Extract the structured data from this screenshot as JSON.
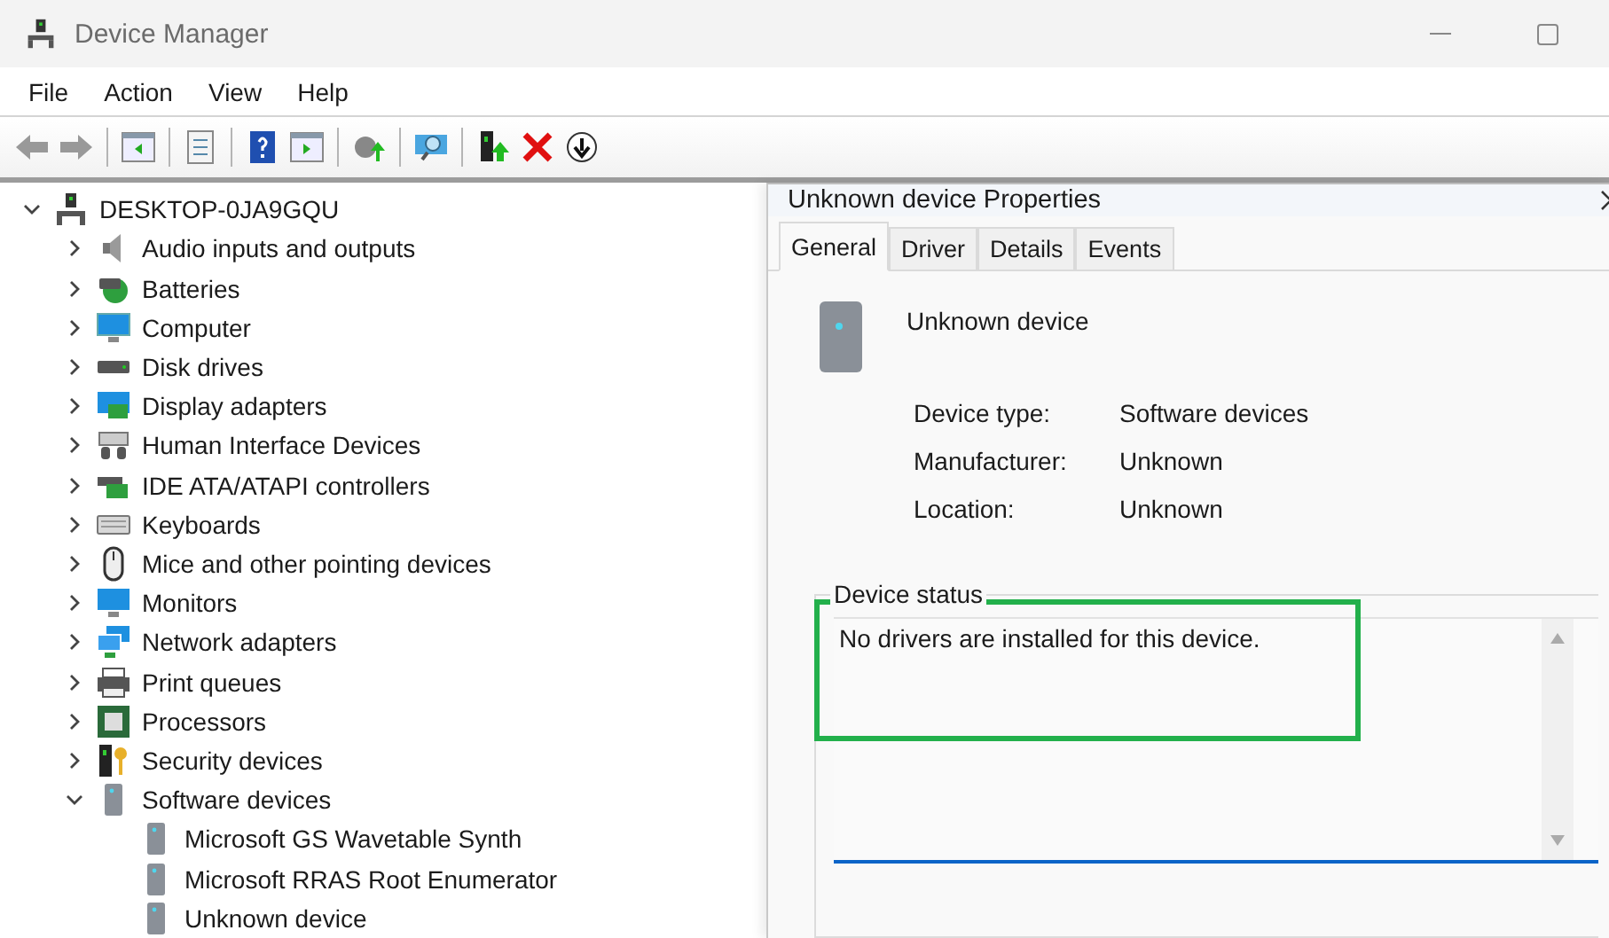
{
  "window": {
    "title": "Device Manager"
  },
  "menu": [
    "File",
    "Action",
    "View",
    "Help"
  ],
  "tree": {
    "label": "DESKTOP-0JA9GQU",
    "expanded": true,
    "children": [
      {
        "label": "Audio inputs and outputs",
        "expanded": false
      },
      {
        "label": "Batteries",
        "expanded": false
      },
      {
        "label": "Computer",
        "expanded": false
      },
      {
        "label": "Disk drives",
        "expanded": false
      },
      {
        "label": "Display adapters",
        "expanded": false
      },
      {
        "label": "Human Interface Devices",
        "expanded": false
      },
      {
        "label": "IDE ATA/ATAPI controllers",
        "expanded": false
      },
      {
        "label": "Keyboards",
        "expanded": false
      },
      {
        "label": "Mice and other pointing devices",
        "expanded": false
      },
      {
        "label": "Monitors",
        "expanded": false
      },
      {
        "label": "Network adapters",
        "expanded": false
      },
      {
        "label": "Print queues",
        "expanded": false
      },
      {
        "label": "Processors",
        "expanded": false
      },
      {
        "label": "Security devices",
        "expanded": false
      },
      {
        "label": "Software devices",
        "expanded": true,
        "children": [
          {
            "label": "Microsoft GS Wavetable Synth"
          },
          {
            "label": "Microsoft RRAS Root Enumerator"
          },
          {
            "label": "Unknown device"
          }
        ]
      }
    ]
  },
  "dialog": {
    "title": "Unknown device Properties",
    "tabs": [
      {
        "label": "General",
        "selected": true
      },
      {
        "label": "Driver",
        "selected": false
      },
      {
        "label": "Details",
        "selected": false
      },
      {
        "label": "Events",
        "selected": false
      }
    ],
    "device_name": "Unknown device",
    "properties": [
      {
        "label": "Device type:",
        "value": "Software devices"
      },
      {
        "label": "Manufacturer:",
        "value": "Unknown"
      },
      {
        "label": "Location:",
        "value": "Unknown"
      }
    ],
    "device_status": {
      "legend": "Device status",
      "text": "No drivers are installed for this device.",
      "highlighted": true
    }
  }
}
